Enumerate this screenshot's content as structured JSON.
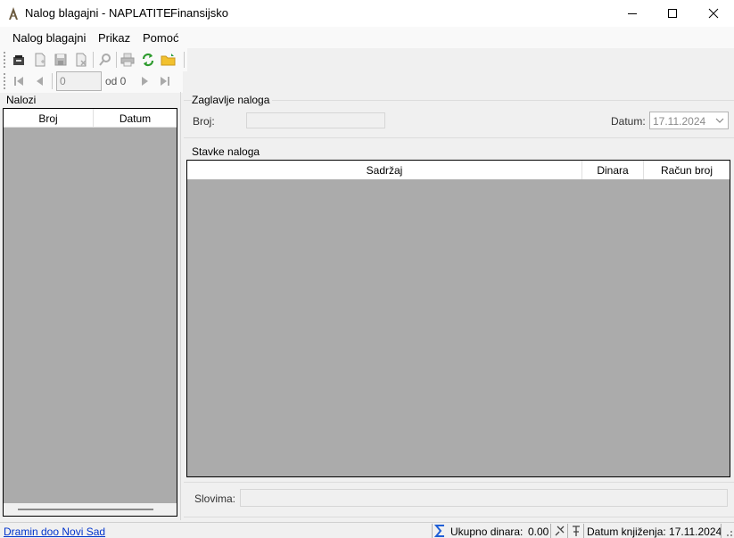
{
  "window": {
    "title": "Nalog blagajni - NAPLATITE",
    "subtitle": "Finansijsko"
  },
  "menu": [
    "Nalog blagajni",
    "Prikaz",
    "Pomoć"
  ],
  "toolbar_icons": [
    "open-icon",
    "new-document-icon",
    "save-icon",
    "delete-document-icon",
    "search-icon",
    "print-icon",
    "refresh-icon",
    "open-folder-icon"
  ],
  "navigator": {
    "position_value": "0",
    "of_label": "od 0"
  },
  "left_panel": {
    "label": "Nalozi",
    "columns": [
      "Broj",
      "Datum"
    ]
  },
  "header_group": {
    "label": "Zaglavlje naloga",
    "broj_label": "Broj:",
    "broj_value": "",
    "datum_label": "Datum:",
    "datum_value": "17.11.2024"
  },
  "items_group": {
    "label": "Stavke naloga",
    "columns": [
      "Sadržaj",
      "Dinara",
      "Račun broj"
    ]
  },
  "slovima": {
    "label": "Slovima:",
    "value": ""
  },
  "status": {
    "company": "Dramin doo  Novi Sad",
    "total_label": "Ukupno dinara:",
    "total_value": "0.00",
    "booking_date": "Datum knjiženja: 17.11.2024"
  },
  "colors": {
    "grid_background": "#ababab",
    "link": "#0033cc",
    "refresh_green": "#2e9b2e",
    "folder_yellow": "#f2c12e",
    "sigma_blue": "#1f5fd6"
  }
}
